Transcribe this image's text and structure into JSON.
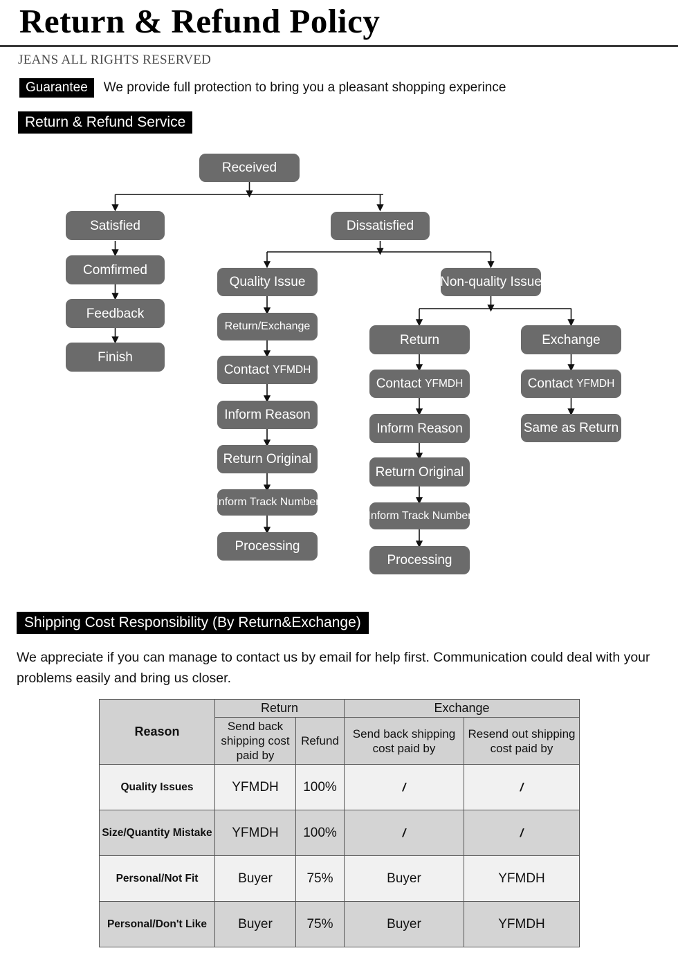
{
  "header": {
    "title": "Return & Refund Policy",
    "rights": "JEANS ALL RIGHTS RESERVED",
    "guarantee_badge": "Guarantee",
    "guarantee_text": "We provide full protection to bring you a pleasant shopping experince",
    "service_badge": "Return & Refund Service"
  },
  "shipping": {
    "badge": "Shipping Cost Responsibility (By Return&Exchange)",
    "paragraph": "We appreciate if you can manage to contact us by email for help first. Communication could deal with your problems easily and bring us closer."
  },
  "flow": {
    "root": "Received",
    "satisfied": "Satisfied",
    "comfirmed": "Comfirmed",
    "feedback": "Feedback",
    "finish": "Finish",
    "dissatisfied": "Dissatisfied",
    "quality_issue": "Quality Issue",
    "q_return_exchange": "Return/Exchange",
    "q_contact": "Contact",
    "q_contact_suffix": "YFMDH",
    "q_inform_reason": "Inform Reason",
    "q_return_original": "Return Original",
    "q_inform_track": "Inform Track Number",
    "q_processing": "Processing",
    "non_quality_issue": "Non-quality Issue",
    "nq_return": "Return",
    "nq_contact": "Contact",
    "nq_contact_suffix": "YFMDH",
    "nq_inform_reason": "Inform Reason",
    "nq_return_original": "Return Original",
    "nq_inform_track": "Inform Track Number",
    "nq_processing": "Processing",
    "nq_exchange": "Exchange",
    "ex_contact": "Contact",
    "ex_contact_suffix": "YFMDH",
    "ex_same_as_return": "Same as Return"
  },
  "table": {
    "group_reason": "Reason",
    "group_return": "Return",
    "group_exchange": "Exchange",
    "col_return_sendback": "Send back shipping cost paid by",
    "col_refund": "Refund",
    "col_exchange_sendback": "Send back shipping cost paid by",
    "col_exchange_resend": "Resend out shipping cost paid by",
    "rows": [
      {
        "reason": "Quality Issues",
        "return_sendback": "YFMDH",
        "refund": "100%",
        "ex_sendback": "/",
        "ex_resend": "/"
      },
      {
        "reason": "Size/Quantity Mistake",
        "return_sendback": "YFMDH",
        "refund": "100%",
        "ex_sendback": "/",
        "ex_resend": "/"
      },
      {
        "reason": "Personal/Not Fit",
        "return_sendback": "Buyer",
        "refund": "75%",
        "ex_sendback": "Buyer",
        "ex_resend": "YFMDH"
      },
      {
        "reason": "Personal/Don't Like",
        "return_sendback": "Buyer",
        "refund": "75%",
        "ex_sendback": "Buyer",
        "ex_resend": "YFMDH"
      }
    ]
  },
  "colors": {
    "node_gray": "#6b6b6b",
    "badge_black": "#000000",
    "table_header_gray": "#d2d2d2",
    "row_light": "#f1f1f1",
    "row_dark": "#d4d4d4"
  }
}
